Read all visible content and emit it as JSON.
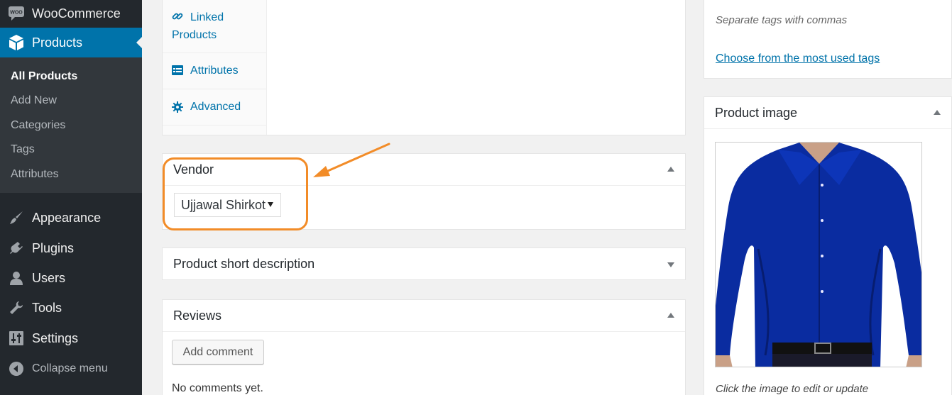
{
  "sidebar": {
    "woocommerce": {
      "label": "WooCommerce",
      "icon": "woocommerce-icon"
    },
    "products": {
      "label": "Products",
      "icon": "products-box-icon"
    },
    "submenu": [
      {
        "label": "All Products",
        "current": true
      },
      {
        "label": "Add New"
      },
      {
        "label": "Categories"
      },
      {
        "label": "Tags"
      },
      {
        "label": "Attributes"
      }
    ],
    "items": [
      {
        "label": "Appearance",
        "icon": "paintbrush-icon"
      },
      {
        "label": "Plugins",
        "icon": "plugin-icon"
      },
      {
        "label": "Users",
        "icon": "users-icon"
      },
      {
        "label": "Tools",
        "icon": "wrench-icon"
      },
      {
        "label": "Settings",
        "icon": "settings-sliders-icon"
      }
    ],
    "collapse": {
      "label": "Collapse menu",
      "icon": "collapse-arrow-icon"
    }
  },
  "product_data_tabs": [
    {
      "label": "Linked Products",
      "icon": "link-icon"
    },
    {
      "label": "Attributes",
      "icon": "list-icon"
    },
    {
      "label": "Advanced",
      "icon": "gear-icon"
    }
  ],
  "vendor": {
    "title": "Vendor",
    "selected": "Ujjawal Shirkot"
  },
  "short_description": {
    "title": "Product short description"
  },
  "reviews": {
    "title": "Reviews",
    "add_button": "Add comment",
    "empty_text": "No comments yet."
  },
  "tags": {
    "hint": "Separate tags with commas",
    "link": "Choose from the most used tags"
  },
  "product_image": {
    "title": "Product image",
    "hint": "Click the image to edit or update"
  },
  "colors": {
    "sidebar_bg": "#23282d",
    "active_menu": "#0073aa",
    "highlight": "#f28c28",
    "shirt": "#0a2ca0"
  }
}
